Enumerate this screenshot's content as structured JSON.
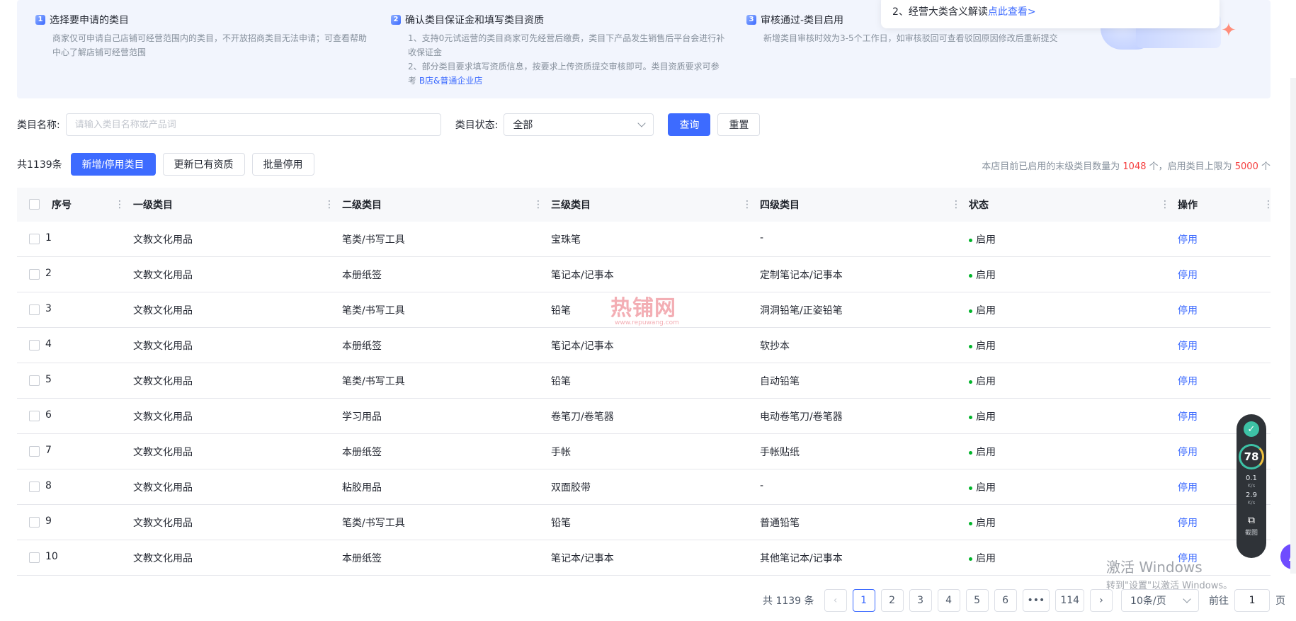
{
  "steps": [
    {
      "num": "1",
      "title": "选择要申请的类目",
      "desc": [
        "商家仅可申请自己店铺可经营范围内的类目，不开放招商类目无法申请；可查看帮助",
        "中心了解店铺可经营范围"
      ]
    },
    {
      "num": "2",
      "title": "确认类目保证金和填写类目资质",
      "desc": [
        "1、支持0元试运营的类目商家可先经营后缴费，类目下产品发生销售后平台会进行补",
        "收保证金",
        "2、部分类目要求填写资质信息，按要求上传资质提交审核即可。类目资质要求可参",
        "考 "
      ],
      "desc_link": "B店&普通企业店"
    },
    {
      "num": "3",
      "title": "审核通过-类目启用",
      "desc": [
        "新增类目审核时效为3-5个工作日，如审核驳回可查看驳回原因修改后重新提交"
      ]
    }
  ],
  "popover": {
    "text": "2、经营大类含义解读",
    "link": "点此查看>"
  },
  "filter": {
    "name_label": "类目名称:",
    "name_placeholder": "请输入类目名称或产品词",
    "status_label": "类目状态:",
    "status_value": "全部",
    "query_label": "查询",
    "reset_label": "重置"
  },
  "toolbar": {
    "total": "共1139条",
    "add_label": "新增/停用类目",
    "update_label": "更新已有资质",
    "batch_label": "批量停用",
    "quota_prefix": "本店目前已启用的末级类目数量为 ",
    "quota_count": "1048",
    "quota_mid": " 个，启用类目上限为 ",
    "quota_limit": "5000",
    "quota_suffix": " 个"
  },
  "table": {
    "headers": [
      "序号",
      "一级类目",
      "二级类目",
      "三级类目",
      "四级类目",
      "状态",
      "操作"
    ],
    "rows": [
      {
        "no": "1",
        "l1": "文教文化用品",
        "l2": "笔类/书写工具",
        "l3": "宝珠笔",
        "l4": "-",
        "status": "启用",
        "op": "停用"
      },
      {
        "no": "2",
        "l1": "文教文化用品",
        "l2": "本册纸签",
        "l3": "笔记本/记事本",
        "l4": "定制笔记本/记事本",
        "status": "启用",
        "op": "停用"
      },
      {
        "no": "3",
        "l1": "文教文化用品",
        "l2": "笔类/书写工具",
        "l3": "铅笔",
        "l4": "洞洞铅笔/正姿铅笔",
        "status": "启用",
        "op": "停用"
      },
      {
        "no": "4",
        "l1": "文教文化用品",
        "l2": "本册纸签",
        "l3": "笔记本/记事本",
        "l4": "软抄本",
        "status": "启用",
        "op": "停用"
      },
      {
        "no": "5",
        "l1": "文教文化用品",
        "l2": "笔类/书写工具",
        "l3": "铅笔",
        "l4": "自动铅笔",
        "status": "启用",
        "op": "停用"
      },
      {
        "no": "6",
        "l1": "文教文化用品",
        "l2": "学习用品",
        "l3": "卷笔刀/卷笔器",
        "l4": "电动卷笔刀/卷笔器",
        "status": "启用",
        "op": "停用"
      },
      {
        "no": "7",
        "l1": "文教文化用品",
        "l2": "本册纸签",
        "l3": "手帐",
        "l4": "手帐贴纸",
        "status": "启用",
        "op": "停用"
      },
      {
        "no": "8",
        "l1": "文教文化用品",
        "l2": "粘胶用品",
        "l3": "双面胶带",
        "l4": "-",
        "status": "启用",
        "op": "停用"
      },
      {
        "no": "9",
        "l1": "文教文化用品",
        "l2": "笔类/书写工具",
        "l3": "铅笔",
        "l4": "普通铅笔",
        "status": "启用",
        "op": "停用"
      },
      {
        "no": "10",
        "l1": "文教文化用品",
        "l2": "本册纸签",
        "l3": "笔记本/记事本",
        "l4": "其他笔记本/记事本",
        "status": "启用",
        "op": "停用"
      }
    ]
  },
  "pagination": {
    "total": "共 1139 条",
    "pages": [
      "1",
      "2",
      "3",
      "4",
      "5",
      "6",
      "•••",
      "114"
    ],
    "current": "1",
    "page_size": "10条/页",
    "goto_label": "前往",
    "goto_value": "1",
    "page_unit": "页"
  },
  "watermark": {
    "main": "热铺网",
    "sub": "www.repuwang.com"
  },
  "windows_notice": {
    "title": "激活 Windows",
    "sub": "转到\"设置\"以激活 Windows。"
  },
  "widget": {
    "score": "78",
    "up": "0.1",
    "up_unit": "K/s",
    "down": "2.9",
    "down_unit": "K/s",
    "shot_label": "截图"
  },
  "colors": {
    "primary": "#3d6bff",
    "success": "#00b42a",
    "danger": "#f53f3f"
  }
}
